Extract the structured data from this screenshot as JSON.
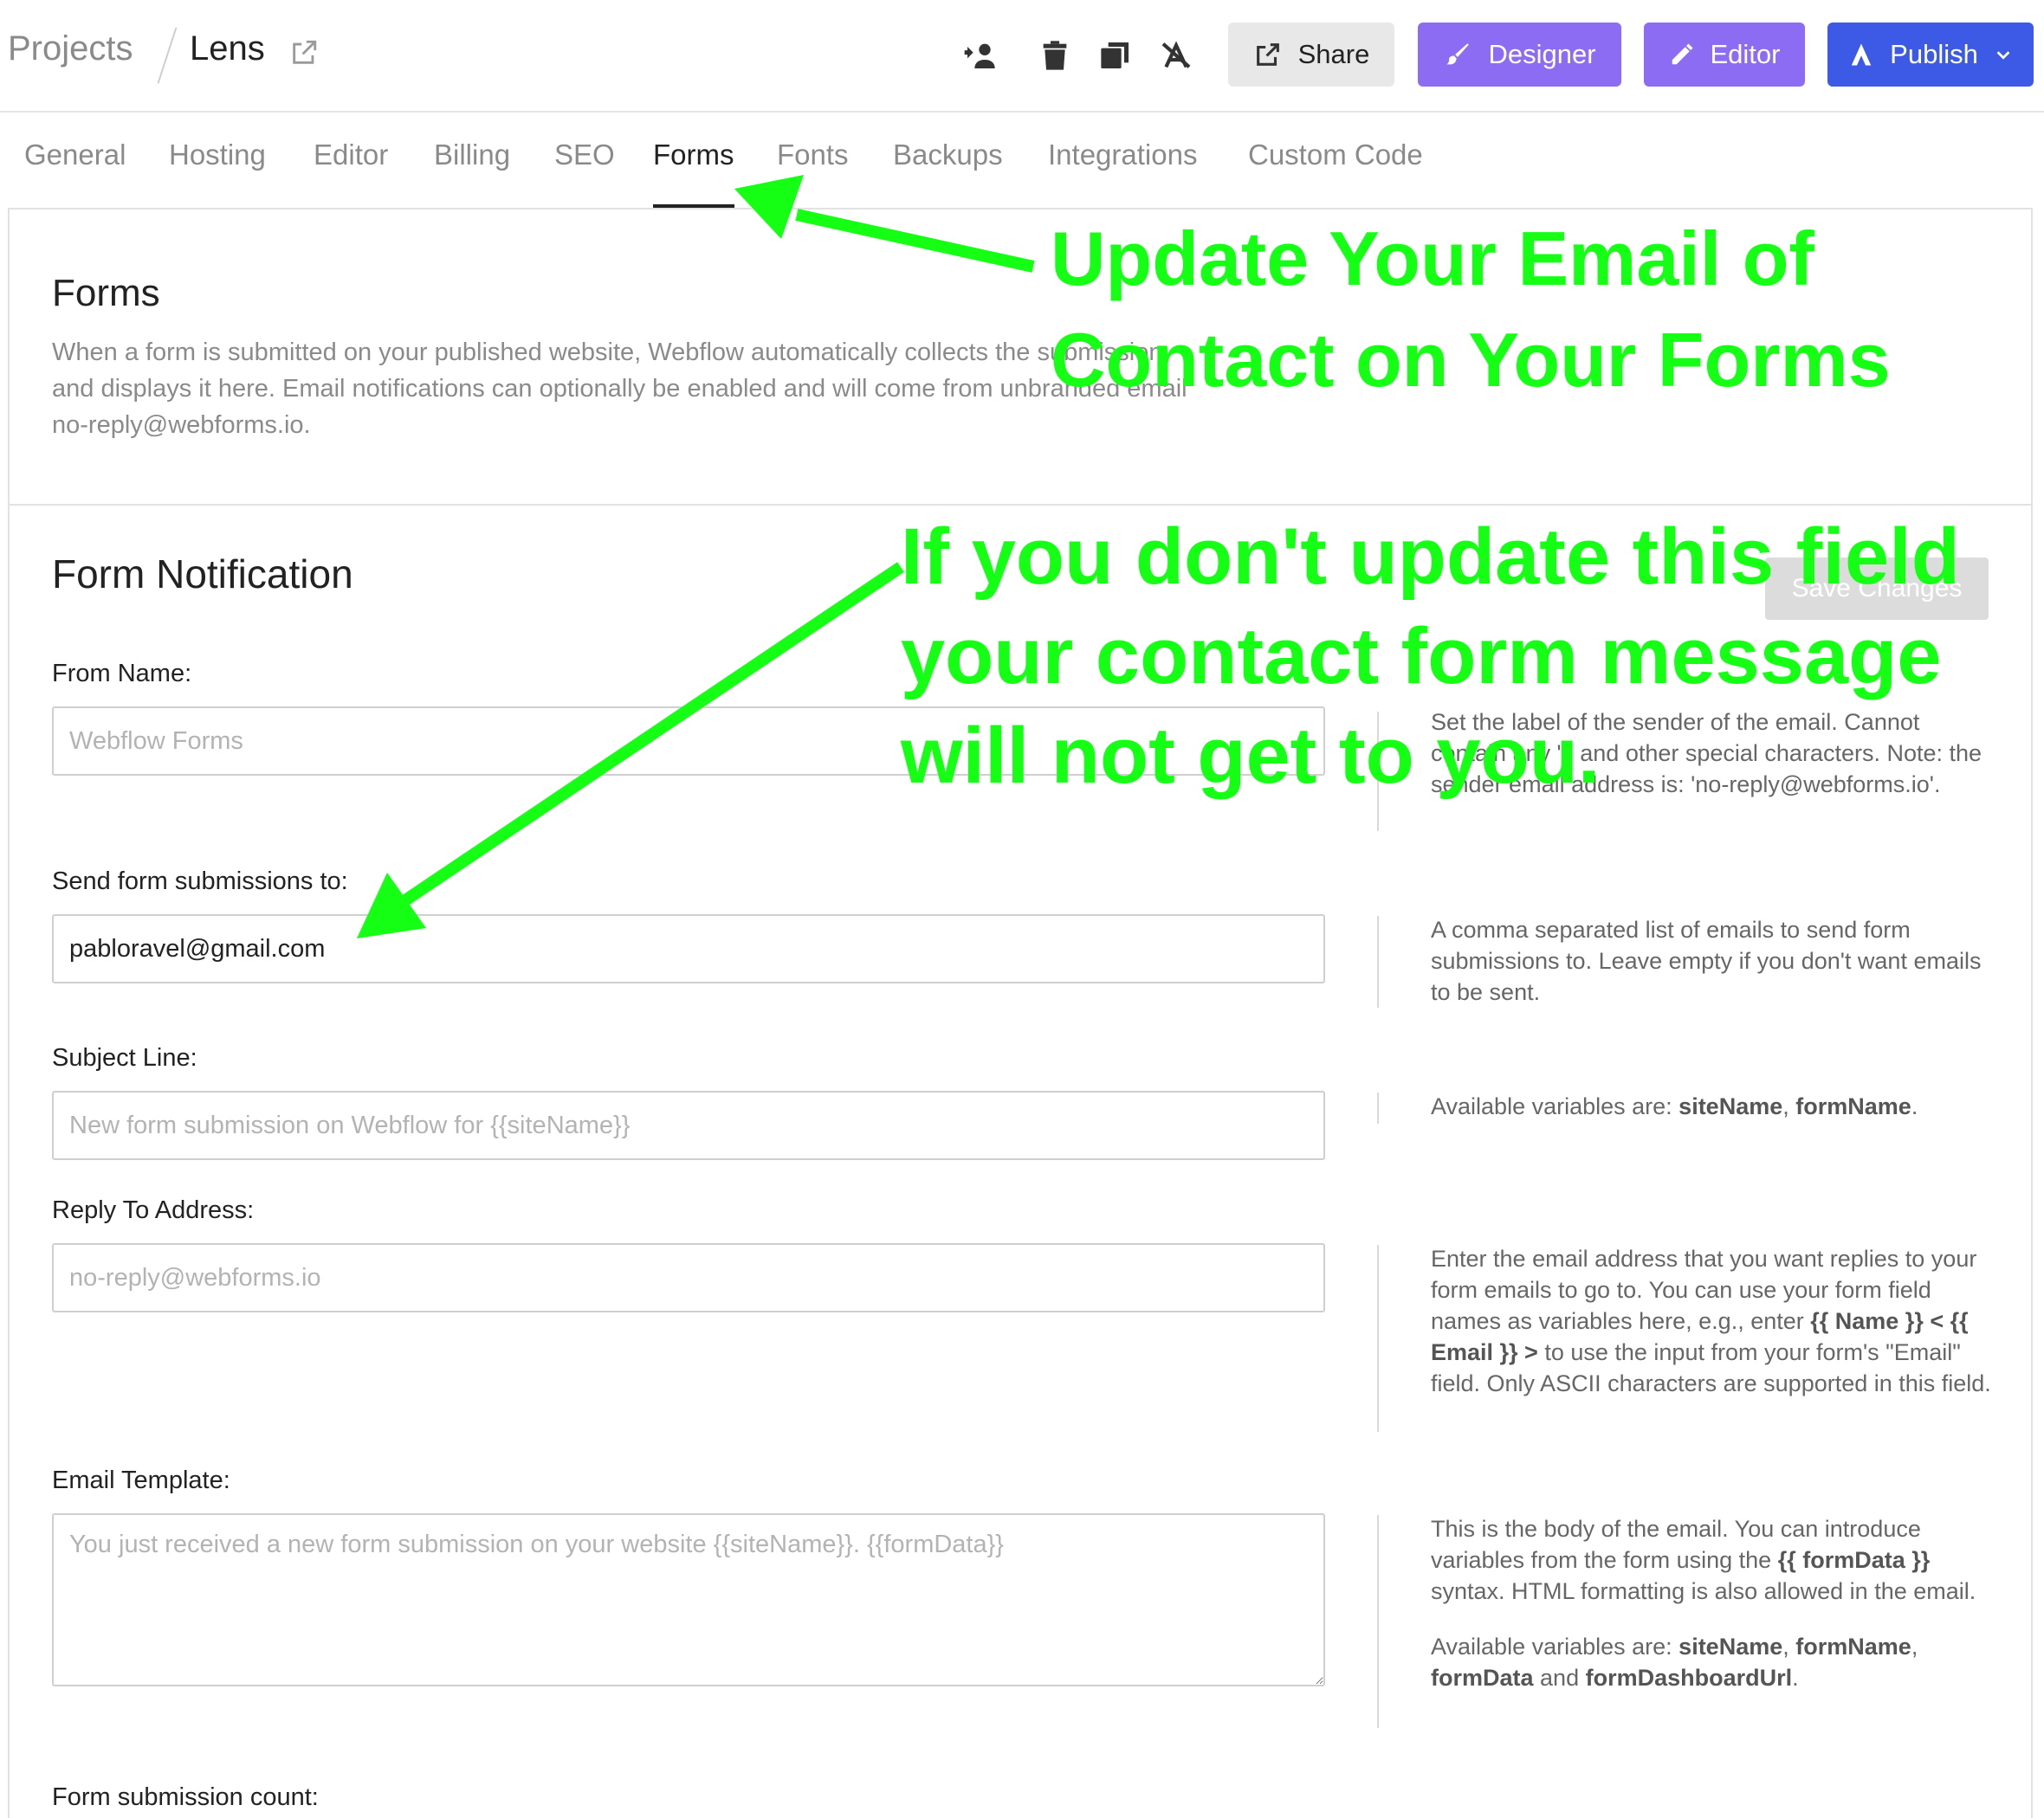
{
  "breadcrumb": {
    "projects": "Projects",
    "site": "Lens"
  },
  "toolbar": {
    "share": "Share",
    "designer": "Designer",
    "editor": "Editor",
    "publish": "Publish"
  },
  "tabs": [
    "General",
    "Hosting",
    "Editor",
    "Billing",
    "SEO",
    "Forms",
    "Fonts",
    "Backups",
    "Integrations",
    "Custom Code"
  ],
  "active_tab": "Forms",
  "forms_section": {
    "title": "Forms",
    "description": "When a form is submitted on your published website, Webflow automatically collects the submission and displays it here. Email notifications can optionally be enabled and will come from unbranded email no-reply@webforms.io."
  },
  "notification": {
    "title": "Form Notification",
    "save_label": "Save Changes",
    "from_name": {
      "label": "From Name:",
      "placeholder": "Webflow Forms",
      "help": "Set the label of the sender of the email. Cannot contain any \"\" and other special characters. Note: the sender email address is: 'no-reply@webforms.io'."
    },
    "send_to": {
      "label": "Send form submissions to:",
      "value": "pabloravel@gmail.com",
      "help": "A comma separated list of emails to send form submissions to. Leave empty if you don't want emails to be sent."
    },
    "subject": {
      "label": "Subject Line:",
      "placeholder": "New form submission on Webflow for {{siteName}}",
      "help_prefix": "Available variables are: ",
      "var1": "siteName",
      "sep": ", ",
      "var2": "formName",
      "end": "."
    },
    "reply_to": {
      "label": "Reply To Address:",
      "placeholder": "no-reply@webforms.io",
      "help_1": "Enter the email address that you want replies to your form emails to go to. You can use your form field names as variables here, e.g., enter ",
      "help_bold": "{{ Name }} < {{ Email }} >",
      "help_2": " to use the input from your form's \"Email\" field. Only ASCII characters are supported in this field."
    },
    "template": {
      "label": "Email Template:",
      "placeholder": "You just received a new form submission on your website {{siteName}}. {{formData}}",
      "help_1": "This is the body of the email. You can introduce variables from the form using the ",
      "help_bold": "{{ formData }}",
      "help_2": " syntax. HTML formatting is also allowed in the email.",
      "vars_prefix": "Available variables are: ",
      "v1": "siteName",
      "s1": ", ",
      "v2": "formName",
      "s2": ", ",
      "v3": "formData",
      "s3": " and ",
      "v4": "formDashboardUrl",
      "s4": "."
    },
    "count_label": "Form submission count:"
  },
  "annotations": {
    "top_line1": "Update Your Email of",
    "top_line2": "Contact on Your Forms",
    "mid_line1": "If you don't update this field",
    "mid_line2": "your contact form message",
    "mid_line3": "will not get to you."
  },
  "colors": {
    "annotation": "#15ff15",
    "designer": "#8c6cf2",
    "publish": "#3c5ae6"
  },
  "icons": [
    "external-link-icon",
    "transfer-user-icon",
    "trash-icon",
    "duplicate-icon",
    "unpublish-icon",
    "share-icon",
    "brush-icon",
    "pencil-icon",
    "publish-icon",
    "chevron-down-icon"
  ]
}
